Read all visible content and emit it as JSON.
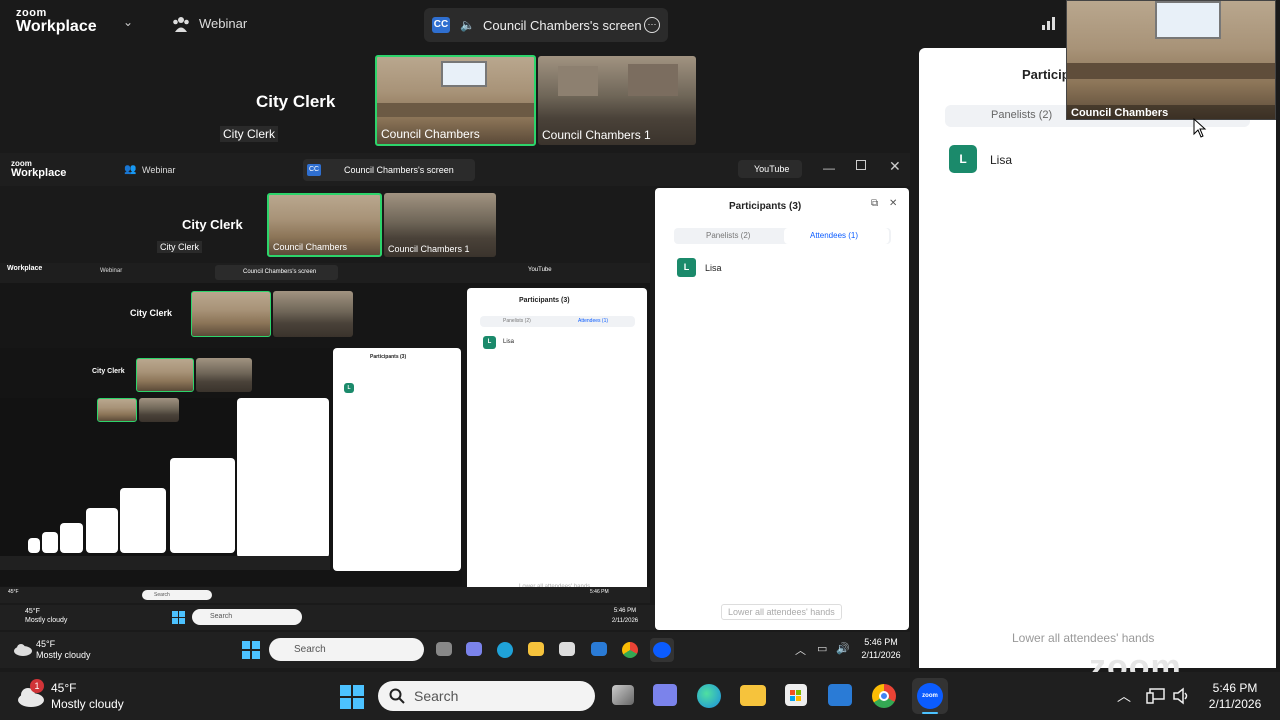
{
  "app": {
    "logo_top": "zoom",
    "logo_bottom": "Workplace"
  },
  "topbar": {
    "mode_label": "Webinar",
    "share_badge": "CC",
    "share_label": "Council Chambers's screen",
    "youtube_label": "YouTube"
  },
  "video": {
    "tile1_title": "City Clerk",
    "tile1_name": "City Clerk",
    "tile2_name": "Council Chambers",
    "tile3_name": "Council Chambers 1",
    "inset_name": "Council Chambers"
  },
  "panel": {
    "title": "Participants (3)",
    "tab_panelists": "Panelists (2)",
    "tab_attendees": "Attendees (1)",
    "attendees": [
      {
        "initial": "L",
        "name": "Lisa"
      }
    ],
    "lower_button": "Lower all attendees' hands",
    "watermark": "zoom"
  },
  "taskbar": {
    "weather_temp": "45°F",
    "weather_desc": "Mostly cloudy",
    "weather_badge": "1",
    "search_placeholder": "Search",
    "time": "5:46 PM",
    "date": "2/11/2026"
  },
  "colors": {
    "accent": "#0b5cff",
    "active_tile": "#2dd46b",
    "avatar": "#1b8a6b",
    "taskbar": "#202020"
  }
}
